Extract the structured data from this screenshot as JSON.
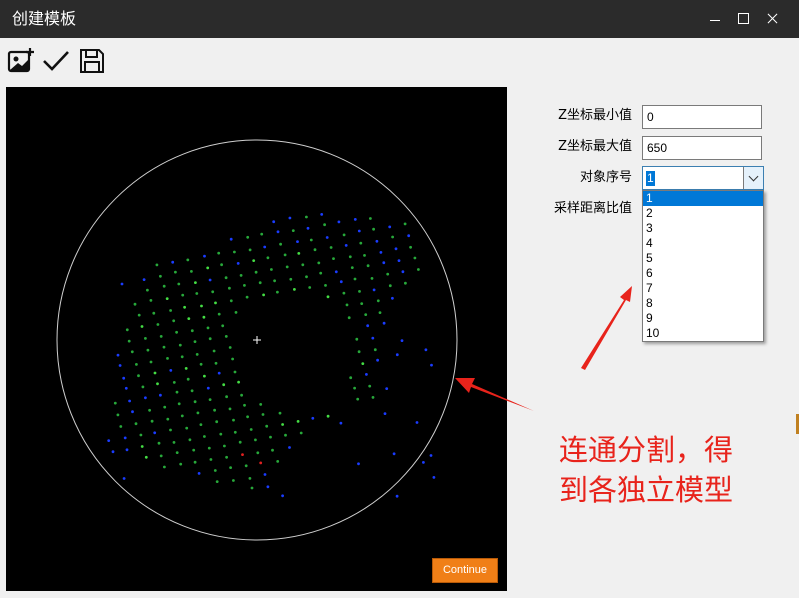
{
  "window": {
    "title": "创建模板"
  },
  "toolbar": {
    "add_image_icon": "add-image-icon",
    "confirm_icon": "check-icon",
    "save_icon": "save-icon"
  },
  "viewport": {
    "continue_label": "Continue",
    "circle_color": "#d0d0d0",
    "point_colors": [
      "#1a3cff",
      "#27a83a",
      "#44dd44",
      "#e02020"
    ]
  },
  "form": {
    "z_min_label": "Z坐标最小值",
    "z_min_value": "0",
    "z_max_label": "Z坐标最大值",
    "z_max_value": "650",
    "object_index_label": "对象序号",
    "object_index_selected": "1",
    "object_index_options": [
      "1",
      "2",
      "3",
      "4",
      "5",
      "6",
      "7",
      "8",
      "9",
      "10"
    ],
    "sampling_ratio_label": "采样距离比值"
  },
  "annotation": {
    "line1": "连通分割，得",
    "line2": "到各独立模型",
    "color": "#e8231b"
  }
}
